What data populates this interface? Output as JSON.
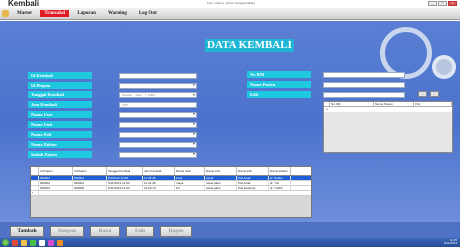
{
  "header": {
    "app_brand": "Kembali",
    "window_title": "Form Utama - [Form Pengembalian]"
  },
  "window_controls": [
    "_",
    "□",
    "X"
  ],
  "menu": [
    {
      "label": "Master"
    },
    {
      "label": "Transaksi",
      "active": true
    },
    {
      "label": "Laporan"
    },
    {
      "label": "Warning"
    },
    {
      "label": "Log Out"
    }
  ],
  "form": {
    "title": "DATA KEMBALI",
    "labels": {
      "id_kembali": "Id Kembali",
      "id_pinjam": "Id Pinjam",
      "tanggal_kembali": "Tanggal Kembali",
      "jam_kembali": "Jam Kembali",
      "nama_user": "Nama User",
      "nama_unit": "Nama Unit",
      "nama_poli": "Nama Poli",
      "nama_dokter": "Nama Dokter",
      "sudah_pasien": "Sudah Pasien"
    },
    "date_parts": [
      "Sunday",
      "June",
      "7, 2009"
    ],
    "jam_value": "0:00",
    "right_labels": {
      "no_rm": "No RM",
      "nama_pasien": "Nama Pasien",
      "edit": "Edit"
    },
    "small_buttons": [
      "...",
      "..."
    ]
  },
  "mini_grid": {
    "columns": [
      "No RM",
      "Nama Pasien",
      "Poli"
    ],
    "new_row_marker": "*"
  },
  "grid": {
    "columns": [
      "Id Pinjam",
      "Id Pinjam",
      "Tanggal Kembali",
      "Jam Kembali",
      "Nama User",
      "Nama Unit",
      "Nama Poli",
      "Nama Dokter"
    ],
    "rows": [
      [
        "000001",
        "000001",
        "5/1/2013 12:00",
        "11:45:48",
        "kosa",
        "rawat",
        "Poli Anak",
        "dr. Dokter"
      ],
      [
        "000002",
        "000004",
        "5/11/2013 12:00",
        "11:31:48",
        "maya",
        "rawat jalan",
        "Poli Anak",
        "dr. Yuli"
      ],
      [
        "000003",
        "000008",
        "5/11/2013 12:00",
        "14:02:14",
        "list",
        "rawat jalan",
        "Poli kandung",
        "dr. Yudhit"
      ]
    ],
    "new_row_marker": "*"
  },
  "actions": {
    "tambah": "Tambah",
    "simpan": "Simpan",
    "batal": "Batal",
    "edit": "Edit",
    "hapus": "Hapus"
  },
  "taskbar": {
    "time": "11:45",
    "date": "6/11/2013"
  }
}
